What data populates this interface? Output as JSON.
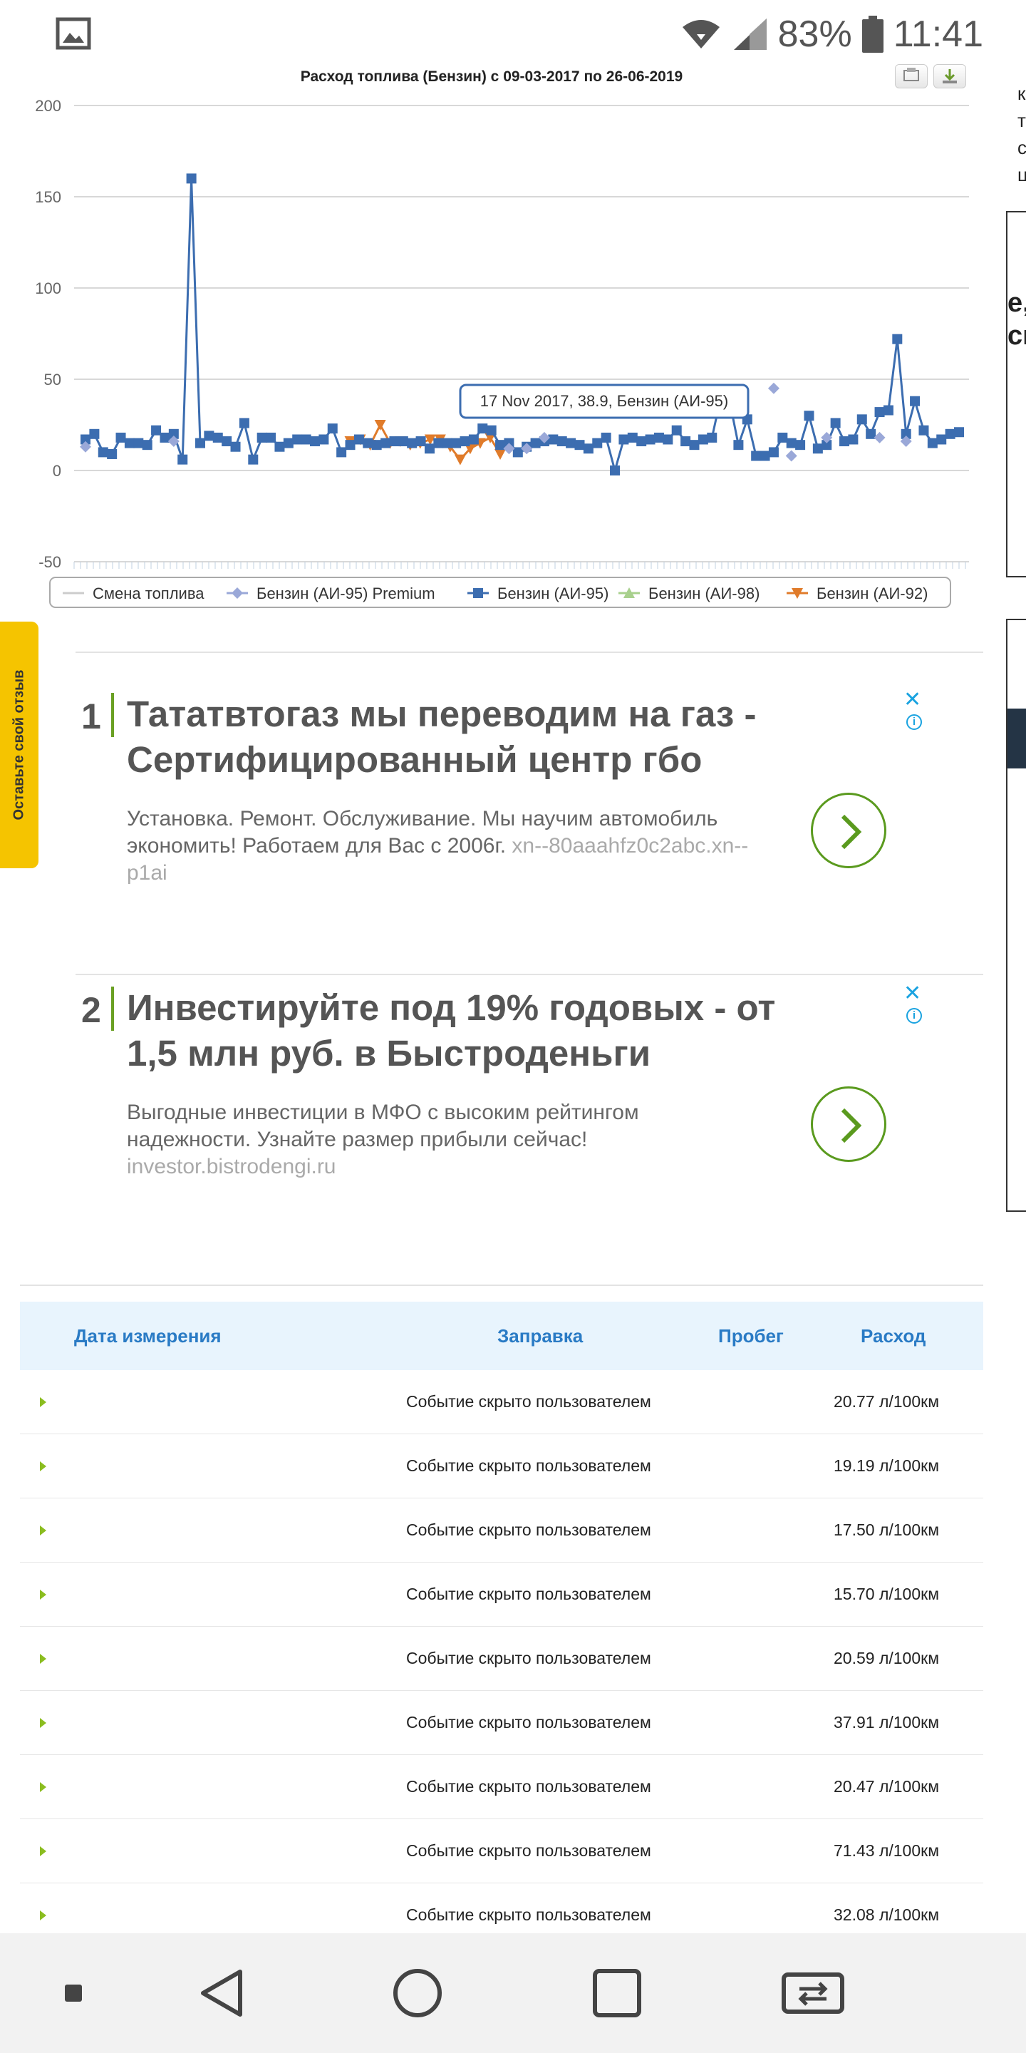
{
  "status_bar": {
    "battery": "83%",
    "time": "11:41",
    "icons": [
      "gallery-icon",
      "wifi-icon",
      "signal-icon",
      "battery-icon"
    ]
  },
  "chart_data": {
    "type": "line",
    "title": "Расход топлива (Бензин) с 09-03-2017 по 26-06-2019",
    "ylim": [
      -50,
      200
    ],
    "y_ticks": [
      "200",
      "150",
      "100",
      "50",
      "0",
      "-50"
    ],
    "grid": true,
    "legend_position": "bottom",
    "tooltip": "17 Nov 2017, 38.9, Бензин (АИ-95)",
    "colors": {
      "Смена топлива": "#cccccc",
      "Бензин (АИ-95) Premium": "#9aa8d8",
      "Бензин (АИ-95)": "#3c6db0",
      "Бензин (АИ-98)": "#a8d08d",
      "Бензин (АИ-92)": "#e07b2a"
    },
    "series": [
      {
        "name": "Бензин (АИ-95) Premium",
        "marker": "diamond",
        "values": [
          13,
          16,
          12,
          12,
          18,
          45,
          8,
          18,
          18,
          16
        ]
      },
      {
        "name": "Бензин (АИ-95)",
        "marker": "square",
        "values": [
          17,
          20,
          10,
          9,
          18,
          15,
          15,
          14,
          22,
          18,
          20,
          6,
          160,
          15,
          19,
          18,
          16,
          13,
          26,
          6,
          18,
          18,
          13,
          15,
          17,
          17,
          16,
          17,
          23,
          10,
          14,
          17,
          15,
          14,
          15,
          16,
          16,
          15,
          16,
          12,
          15,
          15,
          15,
          16,
          17,
          23,
          22,
          14,
          15,
          10,
          13,
          15,
          16,
          17,
          16,
          15,
          14,
          12,
          15,
          18,
          0,
          17,
          18,
          16,
          17,
          18,
          17,
          22,
          16,
          14,
          17,
          18,
          40,
          38,
          14,
          28,
          8,
          8,
          10,
          18,
          15,
          14,
          30,
          12,
          14,
          26,
          16,
          17,
          28,
          20,
          32,
          33,
          72,
          20,
          38,
          22,
          15,
          17,
          20,
          21
        ]
      },
      {
        "name": "Бензин (АИ-98)",
        "marker": "triangle-up",
        "values": []
      },
      {
        "name": "Бензин (АИ-92)",
        "marker": "triangle-down",
        "values": [
          16,
          17,
          14,
          25,
          15,
          16,
          14,
          15,
          17,
          17,
          13,
          6,
          12,
          15,
          18,
          9
        ]
      }
    ],
    "legend": [
      "Смена топлива",
      "Бензин (АИ-95) Premium",
      "Бензин (АИ-95)",
      "Бензин (АИ-98)",
      "Бензин (АИ-92)"
    ]
  },
  "feedback_tab": {
    "label": "Оставьте свой отзыв"
  },
  "edge_text": {
    "right_top": [
      "к",
      "т",
      "с",
      "ц"
    ],
    "right_mid": [
      "е,",
      "сг"
    ]
  },
  "ads": [
    {
      "number": "1",
      "title": "Тататвтогаз мы переводим на газ - Сертифицированный центр гбо",
      "description": "Установка. Ремонт. Обслуживание. Мы научим автомобиль экономить! Работаем для Вас с 2006г.",
      "url": "xn--80aaahfz0c2abc.xn--p1ai"
    },
    {
      "number": "2",
      "title": "Инвестируйте под 19% годовых - от 1,5 млн руб. в Быстроденьги",
      "description": "Выгодные инвестиции в МФО с высоким рейтингом надежности. Узнайте размер прибыли сейчас!",
      "url": "investor.bistrodengi.ru"
    }
  ],
  "table": {
    "headers": {
      "date": "Дата измерения",
      "fuel": "Заправка",
      "mileage": "Пробег",
      "consumption": "Расход"
    },
    "rows": [
      {
        "event": "Событие скрыто пользователем",
        "rate": "20.77 л/100км"
      },
      {
        "event": "Событие скрыто пользователем",
        "rate": "19.19 л/100км"
      },
      {
        "event": "Событие скрыто пользователем",
        "rate": "17.50 л/100км"
      },
      {
        "event": "Событие скрыто пользователем",
        "rate": "15.70 л/100км"
      },
      {
        "event": "Событие скрыто пользователем",
        "rate": "20.59 л/100км"
      },
      {
        "event": "Событие скрыто пользователем",
        "rate": "37.91 л/100км"
      },
      {
        "event": "Событие скрыто пользователем",
        "rate": "20.47 л/100км"
      },
      {
        "event": "Событие скрыто пользователем",
        "rate": "71.43 л/100км"
      },
      {
        "event": "Событие скрыто пользователем",
        "rate": "32.08 л/100км"
      }
    ]
  },
  "nav_bar": {
    "items": [
      "square-dot-icon",
      "back-icon",
      "home-icon",
      "recents-icon",
      "switch-apps-icon"
    ]
  }
}
